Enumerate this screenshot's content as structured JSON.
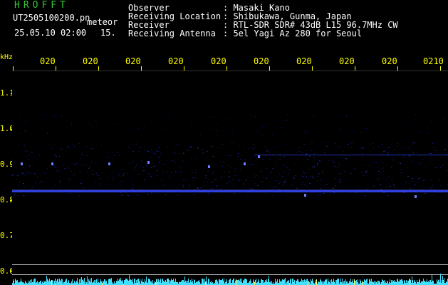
{
  "header": {
    "app_title": "HROFFT",
    "file_name": "UT2505100200.pn",
    "mode": "meteor",
    "timestamp": "25.05.10 02:00",
    "interval": "15."
  },
  "info": [
    {
      "key": "Observer",
      "value": ": Masaki Kano"
    },
    {
      "key": "Receiving Location",
      "value": ": Shibukawa, Gunma, Japan"
    },
    {
      "key": "Receiver",
      "value": ": RTL-SDR SDR# 43dB L15 96.7MHz CW"
    },
    {
      "key": "Receiving Antenna",
      "value": ": 5el Yagi Az 280 for Seoul"
    }
  ],
  "axis": {
    "y_unit": "kHz",
    "y_ticks": [
      "1.1",
      "1.0",
      "0.9",
      "0.8",
      "0.7",
      "0.6"
    ],
    "x_ticks": [
      "020",
      "020",
      "020",
      "020",
      "020",
      "020",
      "020",
      "020",
      "020",
      "0210"
    ]
  },
  "colors": {
    "header_green": "#32c832",
    "axis_yellow": "#ffff00",
    "signal_blue": "#3a4cff",
    "noise_cyan": "#40e0ff"
  }
}
